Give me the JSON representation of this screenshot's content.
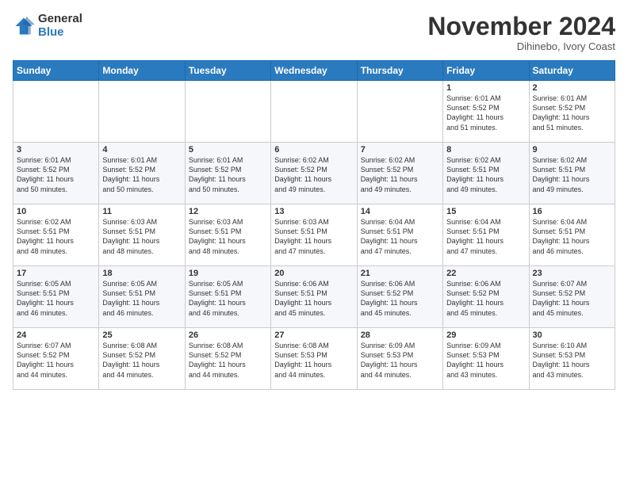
{
  "header": {
    "logo_line1": "General",
    "logo_line2": "Blue",
    "month": "November 2024",
    "location": "Dihinebo, Ivory Coast"
  },
  "weekdays": [
    "Sunday",
    "Monday",
    "Tuesday",
    "Wednesday",
    "Thursday",
    "Friday",
    "Saturday"
  ],
  "weeks": [
    [
      {
        "day": "",
        "content": ""
      },
      {
        "day": "",
        "content": ""
      },
      {
        "day": "",
        "content": ""
      },
      {
        "day": "",
        "content": ""
      },
      {
        "day": "",
        "content": ""
      },
      {
        "day": "1",
        "content": "Sunrise: 6:01 AM\nSunset: 5:52 PM\nDaylight: 11 hours\nand 51 minutes."
      },
      {
        "day": "2",
        "content": "Sunrise: 6:01 AM\nSunset: 5:52 PM\nDaylight: 11 hours\nand 51 minutes."
      }
    ],
    [
      {
        "day": "3",
        "content": "Sunrise: 6:01 AM\nSunset: 5:52 PM\nDaylight: 11 hours\nand 50 minutes."
      },
      {
        "day": "4",
        "content": "Sunrise: 6:01 AM\nSunset: 5:52 PM\nDaylight: 11 hours\nand 50 minutes."
      },
      {
        "day": "5",
        "content": "Sunrise: 6:01 AM\nSunset: 5:52 PM\nDaylight: 11 hours\nand 50 minutes."
      },
      {
        "day": "6",
        "content": "Sunrise: 6:02 AM\nSunset: 5:52 PM\nDaylight: 11 hours\nand 49 minutes."
      },
      {
        "day": "7",
        "content": "Sunrise: 6:02 AM\nSunset: 5:52 PM\nDaylight: 11 hours\nand 49 minutes."
      },
      {
        "day": "8",
        "content": "Sunrise: 6:02 AM\nSunset: 5:51 PM\nDaylight: 11 hours\nand 49 minutes."
      },
      {
        "day": "9",
        "content": "Sunrise: 6:02 AM\nSunset: 5:51 PM\nDaylight: 11 hours\nand 49 minutes."
      }
    ],
    [
      {
        "day": "10",
        "content": "Sunrise: 6:02 AM\nSunset: 5:51 PM\nDaylight: 11 hours\nand 48 minutes."
      },
      {
        "day": "11",
        "content": "Sunrise: 6:03 AM\nSunset: 5:51 PM\nDaylight: 11 hours\nand 48 minutes."
      },
      {
        "day": "12",
        "content": "Sunrise: 6:03 AM\nSunset: 5:51 PM\nDaylight: 11 hours\nand 48 minutes."
      },
      {
        "day": "13",
        "content": "Sunrise: 6:03 AM\nSunset: 5:51 PM\nDaylight: 11 hours\nand 47 minutes."
      },
      {
        "day": "14",
        "content": "Sunrise: 6:04 AM\nSunset: 5:51 PM\nDaylight: 11 hours\nand 47 minutes."
      },
      {
        "day": "15",
        "content": "Sunrise: 6:04 AM\nSunset: 5:51 PM\nDaylight: 11 hours\nand 47 minutes."
      },
      {
        "day": "16",
        "content": "Sunrise: 6:04 AM\nSunset: 5:51 PM\nDaylight: 11 hours\nand 46 minutes."
      }
    ],
    [
      {
        "day": "17",
        "content": "Sunrise: 6:05 AM\nSunset: 5:51 PM\nDaylight: 11 hours\nand 46 minutes."
      },
      {
        "day": "18",
        "content": "Sunrise: 6:05 AM\nSunset: 5:51 PM\nDaylight: 11 hours\nand 46 minutes."
      },
      {
        "day": "19",
        "content": "Sunrise: 6:05 AM\nSunset: 5:51 PM\nDaylight: 11 hours\nand 46 minutes."
      },
      {
        "day": "20",
        "content": "Sunrise: 6:06 AM\nSunset: 5:51 PM\nDaylight: 11 hours\nand 45 minutes."
      },
      {
        "day": "21",
        "content": "Sunrise: 6:06 AM\nSunset: 5:52 PM\nDaylight: 11 hours\nand 45 minutes."
      },
      {
        "day": "22",
        "content": "Sunrise: 6:06 AM\nSunset: 5:52 PM\nDaylight: 11 hours\nand 45 minutes."
      },
      {
        "day": "23",
        "content": "Sunrise: 6:07 AM\nSunset: 5:52 PM\nDaylight: 11 hours\nand 45 minutes."
      }
    ],
    [
      {
        "day": "24",
        "content": "Sunrise: 6:07 AM\nSunset: 5:52 PM\nDaylight: 11 hours\nand 44 minutes."
      },
      {
        "day": "25",
        "content": "Sunrise: 6:08 AM\nSunset: 5:52 PM\nDaylight: 11 hours\nand 44 minutes."
      },
      {
        "day": "26",
        "content": "Sunrise: 6:08 AM\nSunset: 5:52 PM\nDaylight: 11 hours\nand 44 minutes."
      },
      {
        "day": "27",
        "content": "Sunrise: 6:08 AM\nSunset: 5:53 PM\nDaylight: 11 hours\nand 44 minutes."
      },
      {
        "day": "28",
        "content": "Sunrise: 6:09 AM\nSunset: 5:53 PM\nDaylight: 11 hours\nand 44 minutes."
      },
      {
        "day": "29",
        "content": "Sunrise: 6:09 AM\nSunset: 5:53 PM\nDaylight: 11 hours\nand 43 minutes."
      },
      {
        "day": "30",
        "content": "Sunrise: 6:10 AM\nSunset: 5:53 PM\nDaylight: 11 hours\nand 43 minutes."
      }
    ]
  ]
}
